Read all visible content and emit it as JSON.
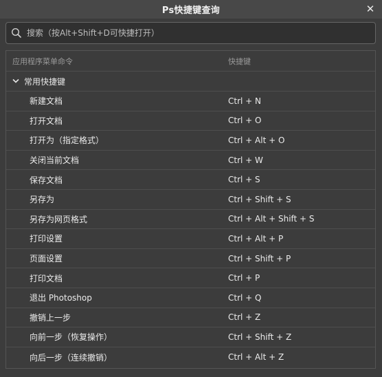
{
  "window": {
    "title": "Ps快捷键查询",
    "close_label": "✕"
  },
  "search": {
    "placeholder": "搜索（按Alt+Shift+D可快捷打开）",
    "value": ""
  },
  "table": {
    "headers": {
      "command": "应用程序菜单命令",
      "shortcut": "快捷键"
    },
    "group": {
      "label": "常用快捷键",
      "expanded": true
    },
    "rows": [
      {
        "command": "新建文档",
        "shortcut": "Ctrl + N"
      },
      {
        "command": "打开文档",
        "shortcut": "Ctrl + O"
      },
      {
        "command": "打开为（指定格式）",
        "shortcut": "Ctrl + Alt + O"
      },
      {
        "command": "关闭当前文档",
        "shortcut": "Ctrl + W"
      },
      {
        "command": "保存文档",
        "shortcut": "Ctrl + S"
      },
      {
        "command": "另存为",
        "shortcut": "Ctrl + Shift + S"
      },
      {
        "command": "另存为网页格式",
        "shortcut": "Ctrl + Alt + Shift + S"
      },
      {
        "command": "打印设置",
        "shortcut": "Ctrl + Alt + P"
      },
      {
        "command": "页面设置",
        "shortcut": "Ctrl + Shift + P"
      },
      {
        "command": "打印文档",
        "shortcut": "Ctrl + P"
      },
      {
        "command": "退出 Photoshop",
        "shortcut": "Ctrl + Q"
      },
      {
        "command": "撤销上一步",
        "shortcut": "Ctrl + Z"
      },
      {
        "command": "向前一步（恢复操作）",
        "shortcut": "Ctrl + Shift + Z"
      },
      {
        "command": "向后一步（连续撤销）",
        "shortcut": "Ctrl + Alt + Z"
      }
    ]
  },
  "icons": {
    "search": "search-icon",
    "close": "close-icon",
    "group_toggle": "chevron-down-icon"
  },
  "colors": {
    "window_bg": "#3c3c3c",
    "titlebar_bg": "#484848",
    "input_bg": "#303030",
    "text": "#e6e6e6",
    "muted_text": "#9a9a9a"
  }
}
